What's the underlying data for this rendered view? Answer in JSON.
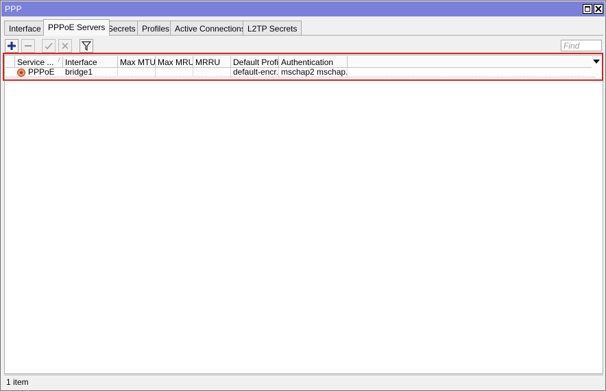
{
  "window": {
    "title": "PPP"
  },
  "tabs": [
    {
      "label": "Interface",
      "active": false
    },
    {
      "label": "PPPoE Servers",
      "active": true
    },
    {
      "label": "Secrets",
      "active": false
    },
    {
      "label": "Profiles",
      "active": false
    },
    {
      "label": "Active Connections",
      "active": false
    },
    {
      "label": "L2TP Secrets",
      "active": false
    }
  ],
  "toolbar": {
    "buttons": [
      {
        "name": "add",
        "icon": "plus-icon",
        "enabled": true
      },
      {
        "name": "remove",
        "icon": "minus-icon",
        "enabled": false
      },
      {
        "name": "enable",
        "icon": "check-icon",
        "enabled": false
      },
      {
        "name": "disable",
        "icon": "x-icon",
        "enabled": false
      },
      {
        "name": "filter",
        "icon": "filter-icon",
        "enabled": true
      }
    ],
    "find_placeholder": "Find"
  },
  "table": {
    "columns": [
      "Service ...",
      "Interface",
      "Max MTU",
      "Max MRU",
      "MRRU",
      "Default Profile",
      "Authentication"
    ],
    "sorted_column": "Service ...",
    "rows": [
      {
        "service": "PPPoE",
        "interface": "bridge1",
        "max_mtu": "",
        "max_mru": "",
        "mrru": "",
        "default_profile": "default-encr...",
        "authentication": "mschap2 mschap..."
      }
    ]
  },
  "status": {
    "item_count": "1 item"
  },
  "colors": {
    "titlebar": "#7b81d9",
    "highlight": "#e02020",
    "add_icon": "#1a2fa0"
  }
}
